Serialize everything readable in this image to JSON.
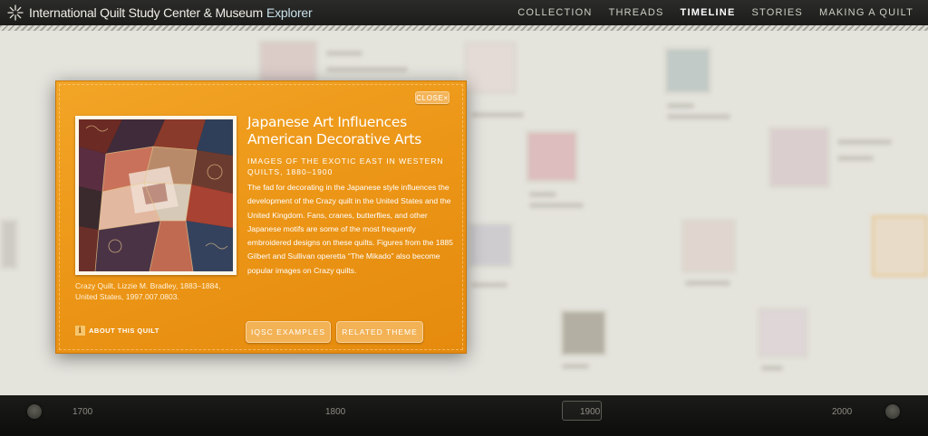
{
  "header": {
    "title": "International Quilt Study Center & Museum",
    "explorer": "Explorer",
    "nav": [
      {
        "label": "COLLECTION",
        "active": false
      },
      {
        "label": "THREADS",
        "active": false
      },
      {
        "label": "TIMELINE",
        "active": true
      },
      {
        "label": "STORIES",
        "active": false
      },
      {
        "label": "MAKING A QUILT",
        "active": false
      }
    ]
  },
  "modal": {
    "close_label": "CLOSE×",
    "title": "Japanese Art Influences American Decorative Arts",
    "subtitle": "IMAGES OF THE EXOTIC EAST IN WESTERN QUILTS, 1880–1900",
    "description": "The fad for decorating in the Japanese style influences the development of the Crazy quilt in the United States and the United Kingdom. Fans, cranes, butterflies, and other Japanese motifs are some of the most frequently embroidered designs on these quilts. Figures from the 1885 Gilbert and Sullivan operetta “The Mikado” also become popular images on Crazy quilts.",
    "caption": "Crazy Quilt, Lizzie M. Bradley, 1883–1884, United States, 1997.007.0803.",
    "about_label": "ABOUT THIS QUILT",
    "info_glyph": "i",
    "iqsc_label": "IQSC EXAMPLES",
    "related_label": "RELATED THEME",
    "accent_color": "#ec9718"
  },
  "timeline": {
    "years": [
      "1700",
      "1800",
      "1900",
      "2000"
    ]
  }
}
